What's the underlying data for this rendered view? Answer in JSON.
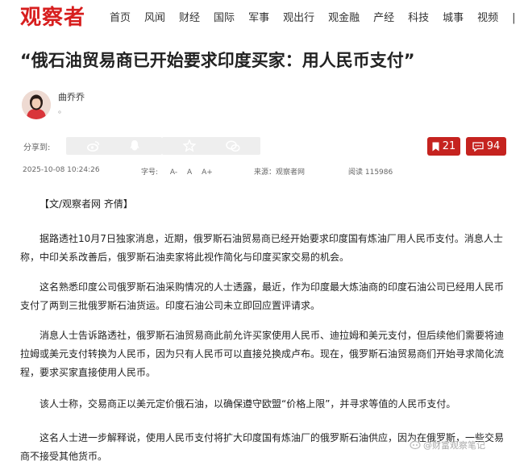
{
  "header": {
    "logo": "观察者",
    "nav": [
      "首页",
      "风闻",
      "财经",
      "国际",
      "军事",
      "观出行",
      "观金融",
      "产经",
      "科技",
      "城事",
      "视频"
    ],
    "nav_separator": "|"
  },
  "article": {
    "title": "“俄石油贸易商已开始要求印度买家：用人民币支付”",
    "author": {
      "name": "曲乔乔",
      "desc": "。"
    },
    "share": {
      "label": "分享到:",
      "targets": [
        "weibo-icon",
        "qq-icon",
        "qzone-star-icon",
        "wechat-icon"
      ]
    },
    "bookmark_count": "21",
    "comment_count": "94",
    "meta": {
      "datetime": "2025-10-08 10:24:26",
      "font_label": "字号:",
      "font_controls": [
        "A-",
        "A",
        "A+"
      ],
      "source": "来源：观察者网",
      "views": "阅读 115986"
    },
    "paragraphs": [
      "【文/观察者网 齐倩】",
      "据路透社10月7日独家消息，近期，俄罗斯石油贸易商已经开始要求印度国有炼油厂用人民币支付。消息人士称，中印关系改善后，俄罗斯石油卖家将此视作简化与印度买家交易的机会。",
      "这名熟悉印度公司俄罗斯石油采购情况的人士透露，最近，作为印度最大炼油商的印度石油公司已经用人民币支付了两到三批俄罗斯石油货运。印度石油公司未立即回应置评请求。",
      "消息人士告诉路透社，俄罗斯石油贸易商此前允许买家使用人民币、迪拉姆和美元支付，但后续他们需要将迪拉姆或美元支付转换为人民币，因为只有人民币可以直接兑换成卢布。现在，俄罗斯石油贸易商们开始寻求简化流程，要求买家直接使用人民币。",
      "该人士称，交易商正以美元定价俄石油，以确保遵守欧盟“价格上限”，并寻求等值的人民币支付。",
      "这名人士进一步解释说，使用人民币支付将扩大印度国有炼油厂的俄罗斯石油供应，因为在俄罗斯，一些交易商不接受其他货币。"
    ]
  },
  "watermark": "@财富观察笔记",
  "colors": {
    "brand_red": "#d71e1e",
    "badge_red": "#c5231f"
  }
}
